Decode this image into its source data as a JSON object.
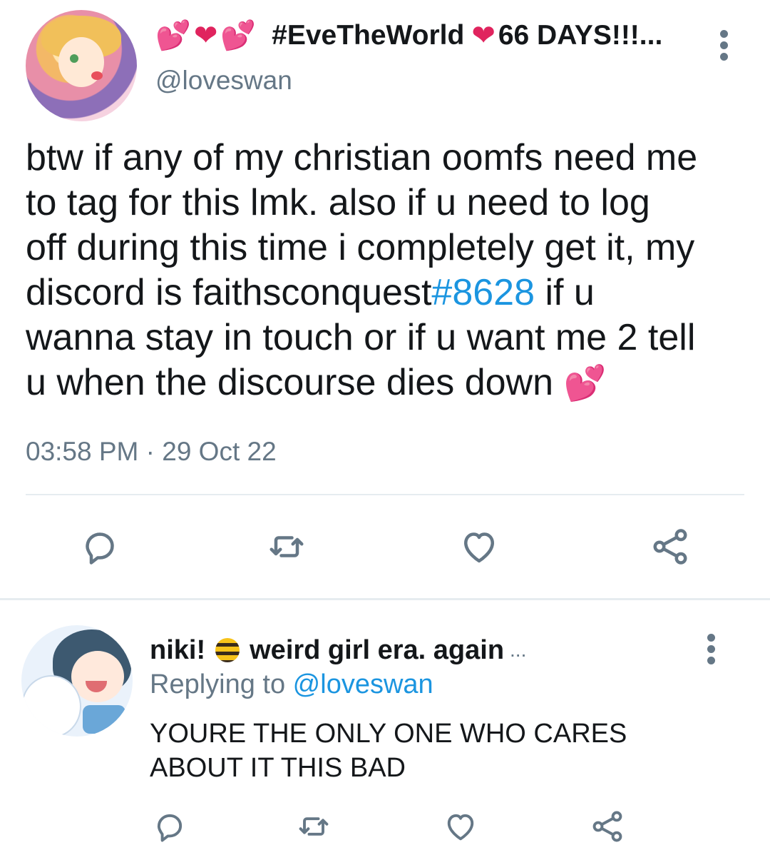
{
  "colors": {
    "accent": "#1b95e0",
    "secondary_text": "#657786",
    "heart": "#e0245e",
    "divider": "#e6ecf0"
  },
  "tweet": {
    "display_name": "#EveTheWorld",
    "display_name_suffix": "66 DAYS!!!...",
    "handle": "@loveswan",
    "text_lines": [
      "btw if any of my christian oomfs need me",
      "to tag for this lmk. also if u need to log",
      "off during this time i completely get it, my"
    ],
    "line4_prefix": "discord is faithsconquest",
    "line4_link": "#8628",
    "line4_suffix": " if u",
    "line5": "wanna stay in touch or if u want me 2 tell",
    "line6": "u when the discourse dies down",
    "timestamp": "03:58 PM · 29 Oct 22",
    "icons": [
      "reply-icon",
      "retweet-icon",
      "like-icon",
      "share-icon"
    ]
  },
  "reply": {
    "display_name": "niki!",
    "display_name_rest": "weird girl era. again",
    "ellipsis": "...",
    "replying_prefix": "Replying to ",
    "replying_handle": "@loveswan",
    "text_lines": [
      "YOURE THE ONLY ONE WHO CARES",
      "ABOUT IT THIS BAD"
    ],
    "icons": [
      "reply-icon",
      "retweet-icon",
      "like-icon",
      "share-icon"
    ]
  }
}
